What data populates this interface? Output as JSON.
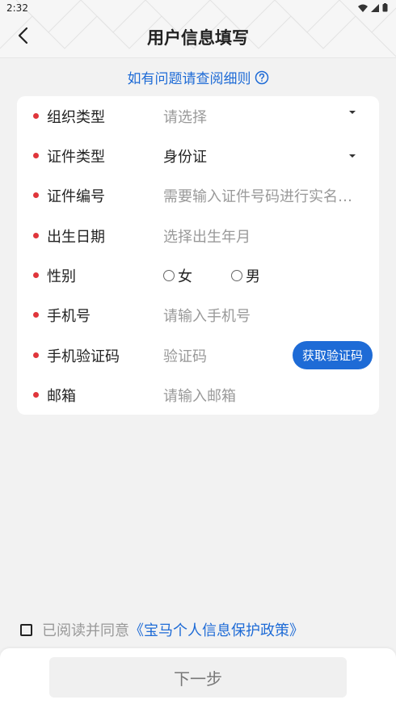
{
  "status_bar": {
    "time": "2:32"
  },
  "header": {
    "title": "用户信息填写",
    "back_icon": "chevron-left-icon"
  },
  "help": {
    "text": "如有问题请查阅细则",
    "icon": "question-circle-icon",
    "color": "#1e6bd6"
  },
  "form": {
    "org_type": {
      "label": "组织类型",
      "placeholder": "请选择"
    },
    "id_type": {
      "label": "证件类型",
      "value": "身份证"
    },
    "id_number": {
      "label": "证件编号",
      "placeholder": "需要输入证件号码进行实名认证"
    },
    "birth_date": {
      "label": "出生日期",
      "placeholder": "选择出生年月"
    },
    "gender": {
      "label": "性别",
      "options": [
        "女",
        "男"
      ]
    },
    "phone": {
      "label": "手机号",
      "placeholder": "请输入手机号"
    },
    "sms_code": {
      "label": "手机验证码",
      "placeholder": "验证码",
      "button_label": "获取验证码"
    },
    "email": {
      "label": "邮箱",
      "placeholder": "请输入邮箱"
    }
  },
  "agreement": {
    "text": "已阅读并同意",
    "link": "《宝马个人信息保护政策》"
  },
  "footer": {
    "next_label": "下一步"
  },
  "colors": {
    "accent": "#1e6bd6",
    "required_dot": "#e0353b",
    "page_bg": "#f2f2f2"
  }
}
